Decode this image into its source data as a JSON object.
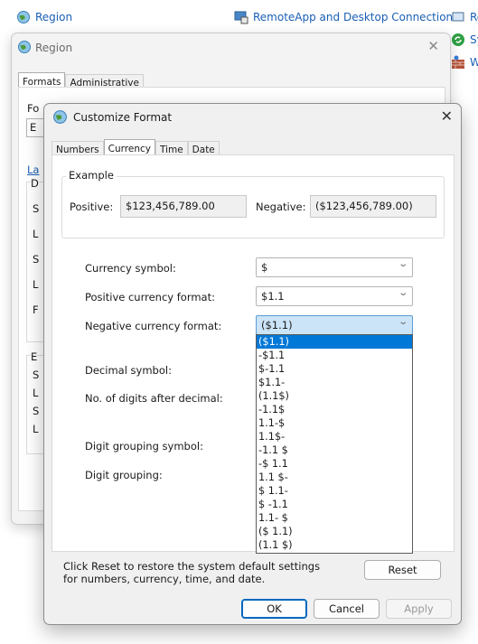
{
  "background": {
    "items": [
      {
        "label": "Region",
        "icon": "globe-icon"
      },
      {
        "label": "RemoteApp and Desktop Connections",
        "icon": "remote-connection-icon"
      },
      {
        "label": "Re",
        "icon": "remoteapp-icon"
      },
      {
        "label": "Sy",
        "icon": "sync-center-icon"
      },
      {
        "label": "W",
        "icon": "windows-firewall-icon"
      }
    ]
  },
  "region_window": {
    "title": "Region",
    "tabs": [
      "Formats",
      "Administrative"
    ],
    "partial_labels": {
      "fo": "Fo",
      "e": "E",
      "la": "La",
      "d": "D",
      "s1": "S",
      "l1": "L",
      "s2": "S",
      "l2": "L",
      "f": "F",
      "e2": "E",
      "s3": "S",
      "l3": "L",
      "s4": "S",
      "l4": "L"
    }
  },
  "dialog": {
    "title": "Customize Format",
    "tabs": [
      "Numbers",
      "Currency",
      "Time",
      "Date"
    ],
    "active_tab": "Currency",
    "example": {
      "legend": "Example",
      "positive_label": "Positive:",
      "positive_value": "$123,456,789.00",
      "negative_label": "Negative:",
      "negative_value": "($123,456,789.00)"
    },
    "fields": {
      "currency_symbol_label": "Currency symbol:",
      "currency_symbol_value": "$",
      "positive_format_label": "Positive currency format:",
      "positive_format_value": "$1.1",
      "negative_format_label": "Negative currency format:",
      "negative_format_value": "($1.1)",
      "decimal_symbol_label": "Decimal symbol:",
      "digits_after_decimal_label": "No. of digits after decimal:",
      "digit_grouping_symbol_label": "Digit grouping symbol:",
      "digit_grouping_label": "Digit grouping:"
    },
    "negative_format_options": [
      "($1.1)",
      "-$1.1",
      "$-1.1",
      "$1.1-",
      "(1.1$)",
      "-1.1$",
      "1.1-$",
      "1.1$-",
      "-1.1 $",
      "-$ 1.1",
      "1.1 $-",
      "$ 1.1-",
      "$ -1.1",
      "1.1- $",
      "($ 1.1)",
      "(1.1 $)"
    ],
    "selected_option_index": 0,
    "reset_note": "Click Reset to restore the system default settings for numbers, currency, time, and date.",
    "buttons": {
      "reset": "Reset",
      "ok": "OK",
      "cancel": "Cancel",
      "apply": "Apply"
    }
  },
  "colors": {
    "accent": "#0078d7",
    "link": "#1a5fb4",
    "open_combo": "#cce4f7"
  }
}
